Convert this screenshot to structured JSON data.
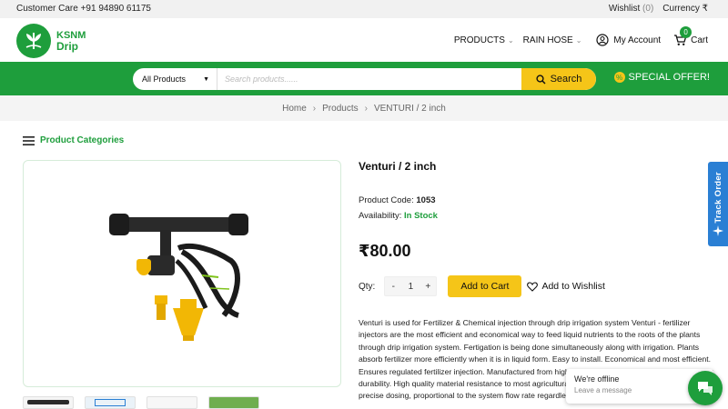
{
  "topbar": {
    "customer_care": "Customer Care +91 94890 61175",
    "wishlist_label": "Wishlist",
    "wishlist_count": "(0)",
    "currency_label": "Currency ₹"
  },
  "brand": {
    "name": "KSNM",
    "sub": "Drip",
    "color": "#1e9e3c"
  },
  "nav": {
    "products": "PRODUCTS",
    "rain_hose": "RAIN HOSE",
    "account": "My Account",
    "cart": "Cart",
    "cart_count": "0"
  },
  "search": {
    "category": "All Products",
    "placeholder": "Search products......",
    "button": "Search"
  },
  "special_offer": "SPECIAL OFFER!",
  "breadcrumb": [
    "Home",
    "Products",
    "VENTURI / 2 inch"
  ],
  "sidebar": {
    "categories_label": "Product Categories"
  },
  "product": {
    "title": "Venturi / 2 inch",
    "code_label": "Product Code:",
    "code": "1053",
    "availability_label": "Availability:",
    "availability": "In Stock",
    "price": "₹80.00",
    "qty_label": "Qty:",
    "qty_minus": "-",
    "qty": "1",
    "qty_plus": "+",
    "add_to_cart": "Add to Cart",
    "add_to_wishlist": "Add to Wishlist",
    "description": "Venturi is used for Fertilizer & Chemical injection through drip irrigation system Venturi - fertilizer injectors are the most efficient and economical way to feed liquid nutrients to the roots of the plants through drip irrigation system. Fertigation is being done simultaneously along with irrigation. Plants absorb fertilizer more efficiently when it is in liquid form. Easy to install. Economical and most efficient. Ensures regulated fertilizer injection. Manufactured from high quality UV stabilized polymer material for durability. High quality material resistance to most agricultural chemicals and fertilizers. Injectors deliver precise dosing, proportional to the system flow rate regardless of pressure or volume."
  },
  "track_order": "Track Order",
  "chat": {
    "status": "We're offline",
    "prompt": "Leave a message"
  },
  "colors": {
    "primary_green": "#1e9e3c",
    "accent_yellow": "#f5c518",
    "track_blue": "#2a7fd4"
  }
}
